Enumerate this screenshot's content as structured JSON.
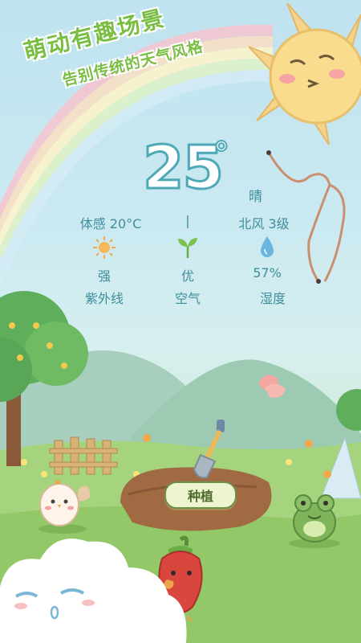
{
  "slogan": {
    "line1": "萌动有趣场景",
    "line2": "告别传统的天气风格"
  },
  "weather": {
    "temperature": "25",
    "unit": "°",
    "condition": "晴",
    "feels_like": "体感 20°C",
    "separator": "|",
    "wind": "北风 3级"
  },
  "stats": [
    {
      "value": "强",
      "label": "紫外线",
      "icon": "sun-icon"
    },
    {
      "value": "优",
      "label": "空气",
      "icon": "sprout-icon"
    },
    {
      "value": "57%",
      "label": "湿度",
      "icon": "water-drop-icon"
    }
  ],
  "action": {
    "plant_label": "种植"
  },
  "colors": {
    "slogan": "#79be43",
    "temperature_outline": "#4ea9b6",
    "text": "#3f8e9b",
    "grass": "#8cc36a"
  }
}
